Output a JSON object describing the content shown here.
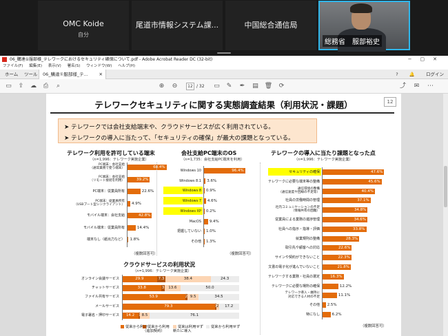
{
  "meeting": {
    "participants": [
      {
        "name": "OMC Koide",
        "note": "自分"
      },
      {
        "name": "尾道市情報システム課..."
      },
      {
        "name": "中国総合通信局"
      },
      {
        "name": "総務省　服部裕史"
      }
    ]
  },
  "window": {
    "title": "06_購達①服部様_テレワークにおけるセキュリティ確保について.pdf - Adobe Acrobat Reader DC (32-bit)",
    "menu": [
      "ファイル(F)",
      "編集(E)",
      "表示(V)",
      "署名(S)",
      "ウィンドウ(W)",
      "ヘルプ(H)"
    ],
    "tabs": {
      "home": "ホーム",
      "tools": "ツール",
      "doc": "06_購達①服部様_テ..."
    },
    "right_actions": {
      "help": "?",
      "bell": "🔔",
      "signin": "ログイン"
    },
    "page_current": "12",
    "page_total": "/ 32"
  },
  "slide": {
    "title": "テレワークセキュリティに関する実態調査結果（利用状況・課題）",
    "page_number": "12",
    "summary": [
      "➤ テレワークでは会社支給端末や、クラウドサービスが広く利用されている。",
      "➤ テレワークの導入に当たって、「セキュリティの確保」が最大の課題となっている。"
    ]
  },
  "chart_data": [
    {
      "type": "bar",
      "title": "テレワーク利用を許可している端末",
      "note": "（n=1,996：テレワーク実施企業）",
      "categories": [
        "PC端末：会社支給\n（通常業務で使う端末）",
        "PC端末：会社支給\n（リモート接続を利用）",
        "PC端末：従業員所有",
        "PC端末：従業員所有\n（USBブート型シンクライアント）",
        "モバイル端末：会社支給",
        "モバイル端末：従業員所有",
        "端末なし（紙出力など）"
      ],
      "values": [
        68.4,
        39.2,
        22.6,
        4.9,
        42.8,
        14.4,
        1.8
      ],
      "footnote": "（複数回答可）"
    },
    {
      "type": "bar",
      "title": "会社支給PC端末のOS",
      "note": "（n=1,735：会社支給PC端末を利用）",
      "categories": [
        "Windows 10",
        "Windows 8.1",
        "Windows 8",
        "Windows 7",
        "Windows XP",
        "MacOS",
        "把握していない",
        "その他"
      ],
      "highlighted": [
        "Windows 8",
        "Windows 7",
        "Windows XP"
      ],
      "values": [
        96.4,
        3.6,
        0.9,
        4.6,
        0.2,
        9.4,
        1.0,
        1.3
      ],
      "footnote": "（複数回答可）"
    },
    {
      "type": "bar",
      "title": "テレワークの導入に当たり課題となった点",
      "note": "（n=1,996：テレワーク実施企業）",
      "categories": [
        "セキュリティの確保",
        "テレワークに必要な端末等の整備",
        "通信環境の整備\n（通信速度や回線の不足等）",
        "社員の労働時間の管理",
        "社内コミュニケーションの不足\n（情報共有の困難）",
        "従業員による業務の進捗管理",
        "社員への指示・指導・評価",
        "就業規則の整備",
        "取引先や顧客への対応",
        "サインや契約ができないこと",
        "文書の電子化が進んでいないこと",
        "テレワークする業務・社員の選定",
        "テレワークに必要な場所の確保",
        "テレワーク導入・維持に\n対応できる人材の不足",
        "その他",
        "特になし"
      ],
      "highlighted": [
        "セキュリティの確保"
      ],
      "values": [
        47.6,
        45.6,
        40.4,
        37.1,
        34.8,
        34.6,
        33.8,
        28.3,
        22.6,
        22.3,
        21.8,
        16.3,
        12.2,
        11.1,
        2.5,
        6.2
      ],
      "footnote": "（複数回答可）"
    },
    {
      "type": "bar",
      "stacked": true,
      "title": "クラウドサービスの利用状況",
      "note": "（n=1,996：テレワーク実施企業）",
      "categories": [
        "オンライン会議サービス",
        "チャットサービス",
        "ファイル共有サービス",
        "メールサービス",
        "電子署名・押印サービス"
      ],
      "series": [
        {
          "name": "従来から利用",
          "values": [
            29.9,
            33.8,
            53.9,
            79.3,
            14.2
          ]
        },
        {
          "name": "従来から利用\n（追加契約）",
          "values": [
            7.3,
            2.6,
            2.0,
            1.2,
            1.0
          ]
        },
        {
          "name": "従来は利用せず\n新たに導入",
          "values": [
            38.4,
            13.6,
            9.5,
            2.2,
            8.5
          ]
        },
        {
          "name": "従来から利用せず",
          "values": [
            24.3,
            50.0,
            34.5,
            17.2,
            76.1
          ]
        }
      ],
      "xlim": [
        0,
        100
      ]
    }
  ]
}
